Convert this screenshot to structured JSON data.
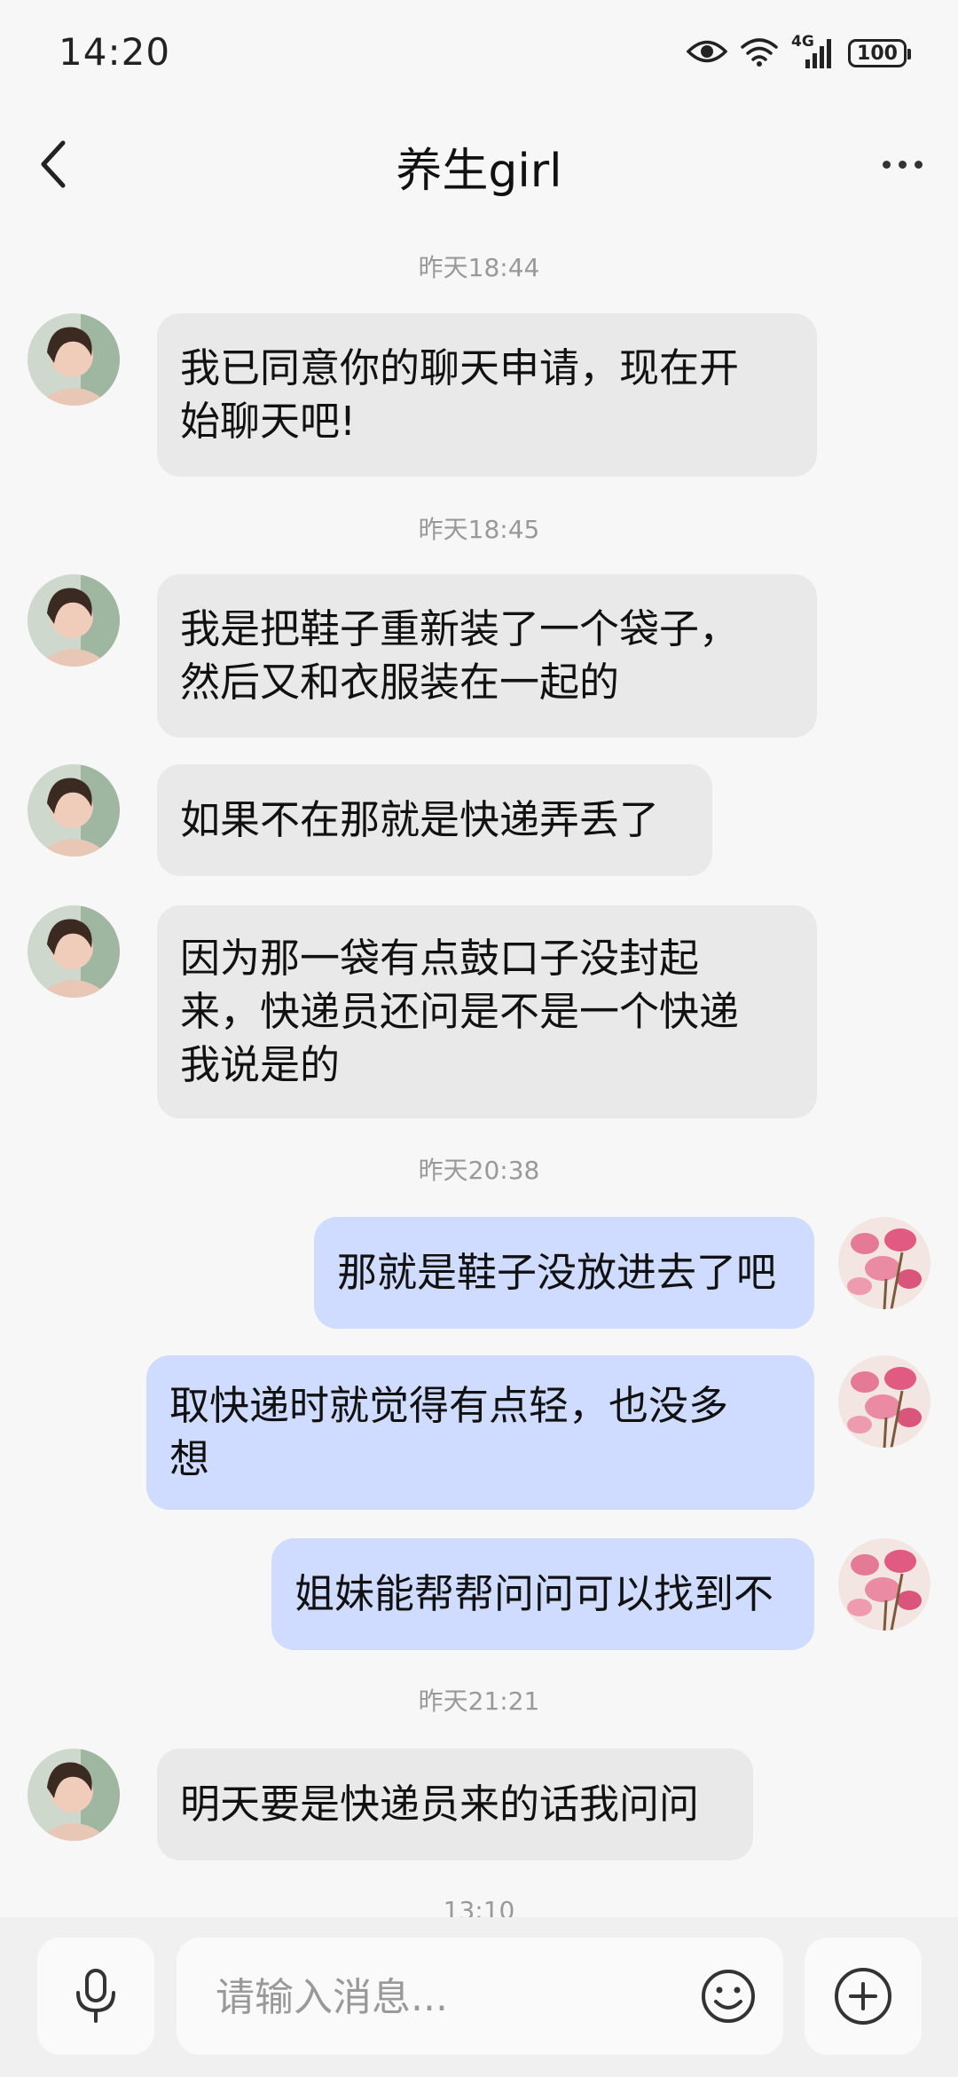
{
  "status_bar": {
    "time": "14:20",
    "network": "4G",
    "battery": "100",
    "icons": [
      "eye-icon",
      "wifi-icon",
      "signal-icon",
      "battery-icon"
    ]
  },
  "header": {
    "title": "养生girl",
    "back_icon": "chevron-left-icon",
    "more_icon": "more-horizontal-icon"
  },
  "messages": {
    "ts1": "昨天18:44",
    "m1": "我已同意你的聊天申请，现在开\n始聊天吧!",
    "ts2": "昨天18:45",
    "m2": "我是把鞋子重新装了一个袋子，\n然后又和衣服装在一起的",
    "m3": "如果不在那就是快递弄丢了",
    "m4": "因为那一袋有点鼓口子没封起\n来，快递员还问是不是一个快递\n我说是的",
    "ts3": "昨天20:38",
    "m5": "那就是鞋子没放进去了吧",
    "m6": "取快递时就觉得有点轻，也没多\n想",
    "m7": "姐妹能帮帮问问可以找到不",
    "ts4": "昨天21:21",
    "m8": "明天要是快递员来的话我问问",
    "ts5": "13:10"
  },
  "input": {
    "placeholder": "请输入消息...",
    "value": "",
    "mic_icon": "microphone-icon",
    "emoji_icon": "emoji-icon",
    "plus_icon": "plus-circle-icon"
  },
  "colors": {
    "background": "#f7f7f7",
    "incoming_bubble": "#e9e9e9",
    "outgoing_bubble": "#cfdcff",
    "timestamp": "#999999"
  }
}
